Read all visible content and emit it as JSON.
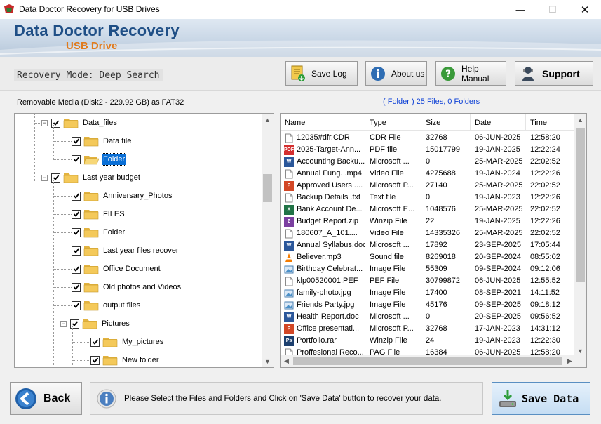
{
  "window": {
    "title": "Data Doctor Recovery for USB Drives",
    "controls": {
      "minimize": "—",
      "maximize": "☐",
      "close": "✕"
    }
  },
  "banner": {
    "brand": "Data Doctor Recovery",
    "subtitle": "USB Drive"
  },
  "toolbar": {
    "mode_text": "Recovery Mode: Deep Search",
    "save_log": "Save Log",
    "about_us": "About us",
    "help_manual": "Help Manual",
    "support": "Support"
  },
  "media_info": "Removable Media (Disk2 - 229.92 GB) as FAT32",
  "folder_info": "( Folder )    25 Files, 0 Folders",
  "tree": [
    {
      "label": "Data_files",
      "level": 1,
      "expander": "−",
      "checked": true,
      "selected": false,
      "open_folder": false
    },
    {
      "label": "Data file",
      "level": 2,
      "expander": "",
      "checked": true,
      "selected": false,
      "open_folder": false
    },
    {
      "label": "Folder",
      "level": 2,
      "expander": "",
      "checked": true,
      "selected": true,
      "open_folder": true
    },
    {
      "label": "Last year budget",
      "level": 1,
      "expander": "−",
      "checked": true,
      "selected": false,
      "open_folder": false
    },
    {
      "label": "Anniversary_Photos",
      "level": 2,
      "expander": "",
      "checked": true,
      "selected": false,
      "open_folder": false
    },
    {
      "label": "FILES",
      "level": 2,
      "expander": "",
      "checked": true,
      "selected": false,
      "open_folder": false
    },
    {
      "label": "Folder",
      "level": 2,
      "expander": "",
      "checked": true,
      "selected": false,
      "open_folder": false
    },
    {
      "label": "Last year files recover",
      "level": 2,
      "expander": "",
      "checked": true,
      "selected": false,
      "open_folder": false
    },
    {
      "label": "Office Document",
      "level": 2,
      "expander": "",
      "checked": true,
      "selected": false,
      "open_folder": false
    },
    {
      "label": "Old photos and Videos",
      "level": 2,
      "expander": "",
      "checked": true,
      "selected": false,
      "open_folder": false
    },
    {
      "label": "output files",
      "level": 2,
      "expander": "",
      "checked": true,
      "selected": false,
      "open_folder": false
    },
    {
      "label": "Pictures",
      "level": 2,
      "expander": "−",
      "checked": true,
      "selected": false,
      "open_folder": false
    },
    {
      "label": "My_pictures",
      "level": 3,
      "expander": "",
      "checked": true,
      "selected": false,
      "open_folder": false
    },
    {
      "label": "New folder",
      "level": 3,
      "expander": "",
      "checked": true,
      "selected": false,
      "open_folder": false
    }
  ],
  "list": {
    "columns": [
      "Name",
      "Type",
      "Size",
      "Date",
      "Time"
    ],
    "rows": [
      {
        "icon": "cdr-file-icon",
        "color": "#ffffff",
        "name": "12035#dfr.CDR",
        "type": "CDR File",
        "size": "32768",
        "date": "06-JUN-2025",
        "time": "12:58:20"
      },
      {
        "icon": "pdf-file-icon",
        "color": "#d32f2f",
        "name": "2025-Target-Ann...",
        "type": "PDF file",
        "size": "15017799",
        "date": "19-JAN-2025",
        "time": "12:22:24"
      },
      {
        "icon": "word-file-icon",
        "color": "#2b579a",
        "name": "Accounting Backu...",
        "type": "Microsoft ...",
        "size": "0",
        "date": "25-MAR-2025",
        "time": "22:02:52"
      },
      {
        "icon": "video-file-icon",
        "color": "#ffffff",
        "name": "Annual Fung. .mp4",
        "type": "Video File",
        "size": "4275688",
        "date": "19-JAN-2024",
        "time": "12:22:26"
      },
      {
        "icon": "ppt-file-icon",
        "color": "#d24726",
        "name": "Approved Users ....",
        "type": "Microsoft P...",
        "size": "27140",
        "date": "25-MAR-2025",
        "time": "22:02:52"
      },
      {
        "icon": "text-file-icon",
        "color": "#ffffff",
        "name": "Backup Details .txt",
        "type": "Text file",
        "size": "0",
        "date": "19-JAN-2023",
        "time": "12:22:26"
      },
      {
        "icon": "excel-file-icon",
        "color": "#217346",
        "name": "Bank Account De...",
        "type": "Microsoft E...",
        "size": "1048576",
        "date": "25-MAR-2025",
        "time": "22:02:52"
      },
      {
        "icon": "zip-file-icon",
        "color": "#7b3fa0",
        "name": "Budget Report.zip",
        "type": "Winzip File",
        "size": "22",
        "date": "19-JAN-2025",
        "time": "12:22:26"
      },
      {
        "icon": "video-file-icon",
        "color": "#ffffff",
        "name": "180607_A_101....",
        "type": "Video File",
        "size": "14335326",
        "date": "25-MAR-2025",
        "time": "22:02:52"
      },
      {
        "icon": "word-file-icon",
        "color": "#2b579a",
        "name": "Annual Syllabus.doc",
        "type": "Microsoft ...",
        "size": "17892",
        "date": "23-SEP-2025",
        "time": "17:05:44"
      },
      {
        "icon": "mp3-file-icon",
        "color": "#f57c00",
        "name": "Believer.mp3",
        "type": "Sound file",
        "size": "8269018",
        "date": "20-SEP-2024",
        "time": "08:55:02"
      },
      {
        "icon": "image-file-icon",
        "color": "#4a90c8",
        "name": "Birthday Celebrat...",
        "type": "Image File",
        "size": "55309",
        "date": "09-SEP-2024",
        "time": "09:12:06"
      },
      {
        "icon": "pef-file-icon",
        "color": "#ffffff",
        "name": "klp00520001.PEF",
        "type": "PEF File",
        "size": "30799872",
        "date": "06-JUN-2025",
        "time": "12:55:52"
      },
      {
        "icon": "image-file-icon",
        "color": "#4a90c8",
        "name": "family-photo.jpg",
        "type": "Image File",
        "size": "17400",
        "date": "08-SEP-2021",
        "time": "14:11:52"
      },
      {
        "icon": "image-file-icon",
        "color": "#4a90c8",
        "name": "Friends Party.jpg",
        "type": "Image File",
        "size": "45176",
        "date": "09-SEP-2025",
        "time": "09:18:12"
      },
      {
        "icon": "word-file-icon",
        "color": "#2b579a",
        "name": "Health Report.doc",
        "type": "Microsoft ...",
        "size": "0",
        "date": "20-SEP-2025",
        "time": "09:56:52"
      },
      {
        "icon": "ppt-file-icon",
        "color": "#d24726",
        "name": "Office presentati...",
        "type": "Microsoft P...",
        "size": "32768",
        "date": "17-JAN-2023",
        "time": "14:31:12"
      },
      {
        "icon": "psd-file-icon",
        "color": "#1c3f6e",
        "name": "Portfolio.rar",
        "type": "Winzip File",
        "size": "24",
        "date": "19-JAN-2023",
        "time": "12:22:30"
      },
      {
        "icon": "pag-file-icon",
        "color": "#ffffff",
        "name": "Proffesional Reco...",
        "type": "PAG File",
        "size": "16384",
        "date": "06-JUN-2025",
        "time": "12:58:20"
      }
    ]
  },
  "bottom": {
    "back": "Back",
    "message": "Please Select the Files and Folders and Click on 'Save Data' button to recover your data.",
    "save_data": "Save Data"
  }
}
